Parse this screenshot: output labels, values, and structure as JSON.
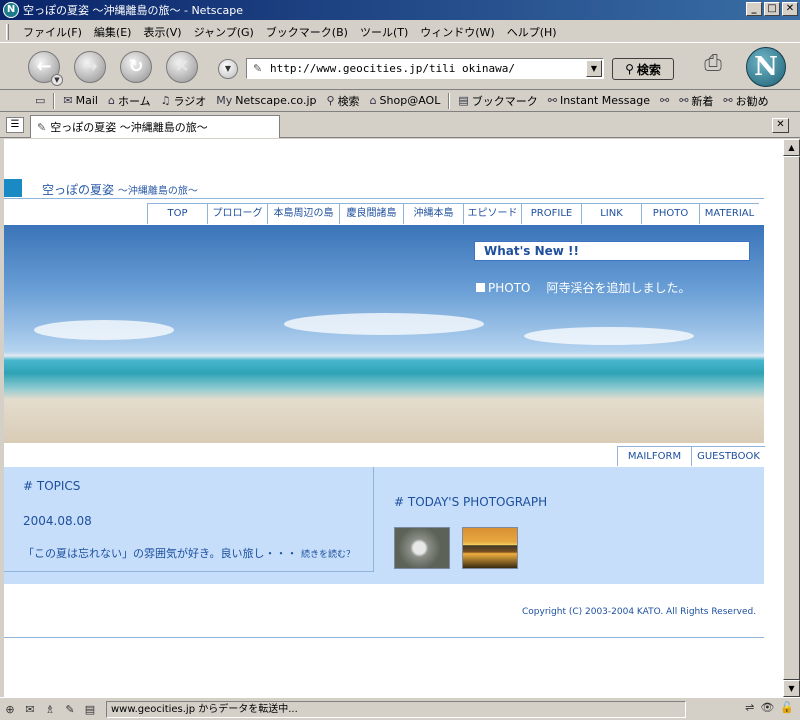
{
  "window": {
    "title": "空っぽの夏姿 〜沖縄離島の旅〜 - Netscape",
    "app_icon": "N",
    "buttons": {
      "minimize": "_",
      "maximize": "□",
      "close": "✕"
    }
  },
  "menubar": {
    "items": [
      "ファイル(F)",
      "編集(E)",
      "表示(V)",
      "ジャンプ(G)",
      "ブックマーク(B)",
      "ツール(T)",
      "ウィンドウ(W)",
      "ヘルプ(H)"
    ]
  },
  "navbar": {
    "url": "http://www.geocities.jp/tili okinawa/",
    "search_label": "検索",
    "back": "←",
    "forward": "→",
    "reload": "↻",
    "stop": "✕",
    "logo": "N"
  },
  "personal_toolbar": {
    "items": [
      {
        "icon": "mail-icon",
        "glyph": "✉",
        "label": "Mail"
      },
      {
        "icon": "home-icon",
        "glyph": "⌂",
        "label": "ホーム"
      },
      {
        "icon": "radio-icon",
        "glyph": "♫",
        "label": "ラジオ"
      },
      {
        "icon": "netscape-my-icon",
        "glyph": "My",
        "label": "Netscape.co.jp"
      },
      {
        "icon": "search-icon",
        "glyph": "⚲",
        "label": "検索"
      },
      {
        "icon": "shop-icon",
        "glyph": "⌂",
        "label": "Shop@AOL"
      },
      {
        "icon": "bookmark-icon",
        "glyph": "▤",
        "label": "ブックマーク"
      },
      {
        "icon": "link-icon",
        "glyph": "⚯",
        "label": "Instant Message"
      },
      {
        "icon": "link-icon",
        "glyph": "⚯",
        "label": ""
      },
      {
        "icon": "link-icon",
        "glyph": "⚯",
        "label": "新着"
      },
      {
        "icon": "link-icon",
        "glyph": "⚯",
        "label": "お勧め"
      }
    ]
  },
  "tab": {
    "label": "空っぽの夏姿 〜沖縄離島の旅〜",
    "close": "✕"
  },
  "page": {
    "site_title": "空っぽの夏姿",
    "site_subtitle": "〜沖縄離島の旅〜",
    "nav": [
      "TOP",
      "プロローグ",
      "本島周辺の島",
      "慶良間諸島",
      "沖縄本島",
      "エピソード",
      "PROFILE",
      "LINK",
      "PHOTO",
      "MATERIAL"
    ],
    "whats_new": {
      "title": "What's New !!",
      "category": "PHOTO",
      "text": "阿寺渓谷を追加しました。"
    },
    "subnav": [
      "MAILFORM",
      "GUESTBOOK"
    ],
    "topics": {
      "heading": "#  TOPICS",
      "date": "2004.08.08",
      "text": "「この夏は忘れない」の雰囲気が好き。良い旅し・・・",
      "more": "続きを読む？"
    },
    "todays_photo": {
      "heading": "#  TODAY'S PHOTOGRAPH"
    },
    "copyright": "Copyright (C) 2003-2004 KATO. All Rights Reserved."
  },
  "statusbar": {
    "text": "www.geocities.jp からデータを転送中..."
  }
}
